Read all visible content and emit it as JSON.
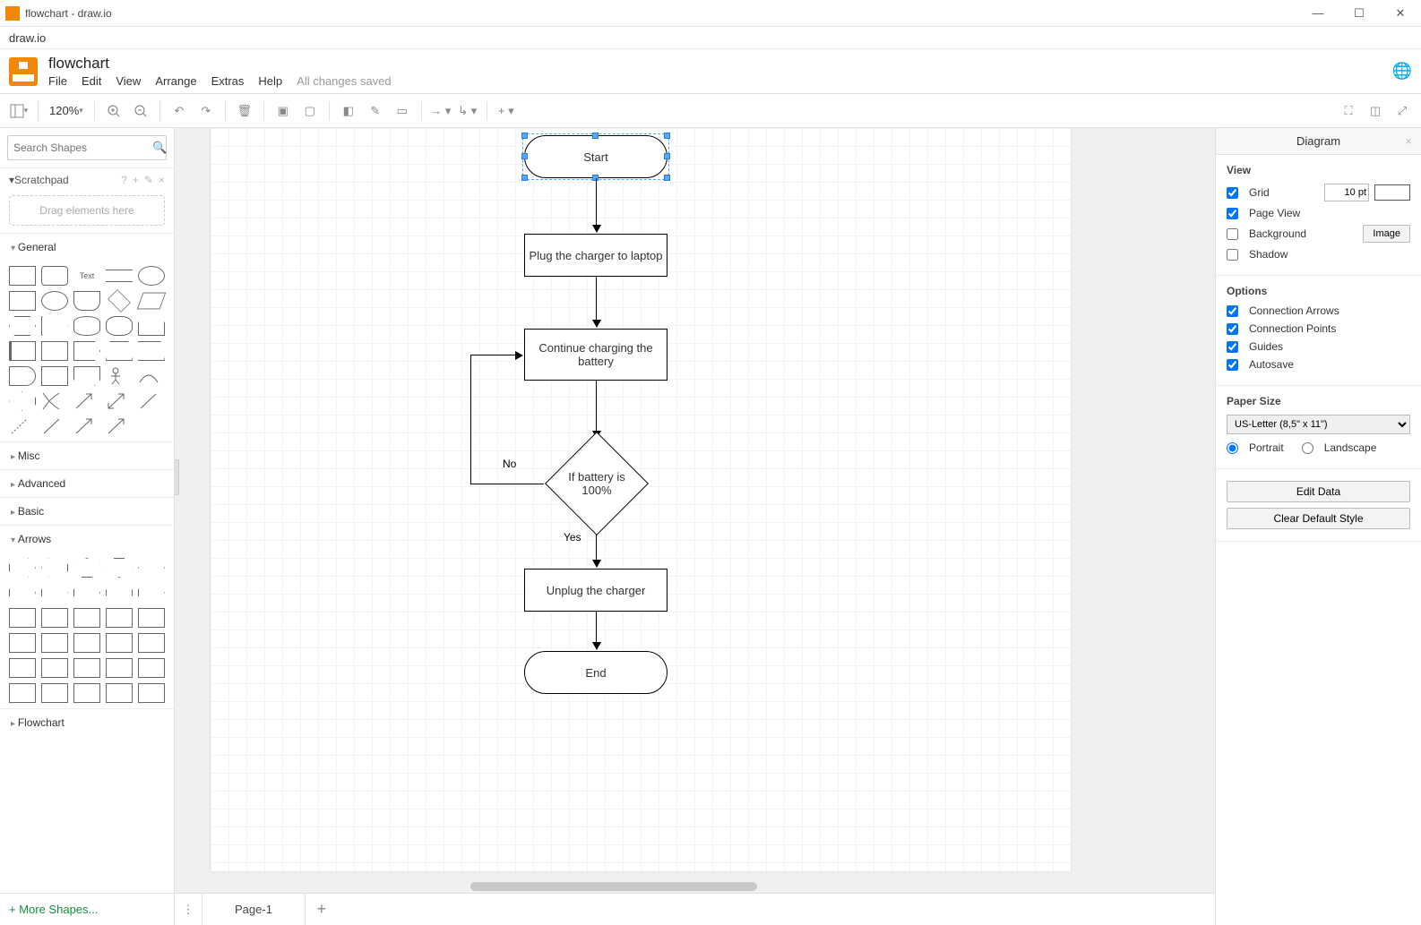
{
  "window_title": "flowchart - draw.io",
  "browser_label": "draw.io",
  "filename": "flowchart",
  "menu": {
    "file": "File",
    "edit": "Edit",
    "view": "View",
    "arrange": "Arrange",
    "extras": "Extras",
    "help": "Help",
    "saved": "All changes saved"
  },
  "toolbar": {
    "zoom": "120%"
  },
  "sidebar": {
    "search_placeholder": "Search Shapes",
    "scratchpad": "Scratchpad",
    "drop_hint": "Drag elements here",
    "cats": {
      "general": "General",
      "misc": "Misc",
      "advanced": "Advanced",
      "basic": "Basic",
      "arrows": "Arrows",
      "flowchart": "Flowchart"
    },
    "text_shape": "Text",
    "more": "+ More Shapes..."
  },
  "pagebar": {
    "tab": "Page-1"
  },
  "flow": {
    "start": "Start",
    "plug": "Plug the charger to laptop",
    "cont": "Continue charging the battery",
    "cond": "If battery is 100%",
    "unplug": "Unplug the charger",
    "end": "End",
    "no": "No",
    "yes": "Yes"
  },
  "format": {
    "title": "Diagram",
    "view": "View",
    "grid": "Grid",
    "grid_val": "10 pt",
    "pageview": "Page View",
    "background": "Background",
    "image_btn": "Image",
    "shadow": "Shadow",
    "options": "Options",
    "conn_arrows": "Connection Arrows",
    "conn_points": "Connection Points",
    "guides": "Guides",
    "autosave": "Autosave",
    "paper": "Paper Size",
    "paper_val": "US-Letter (8,5\" x 11\")",
    "portrait": "Portrait",
    "landscape": "Landscape",
    "edit_data": "Edit Data",
    "clear_style": "Clear Default Style"
  }
}
